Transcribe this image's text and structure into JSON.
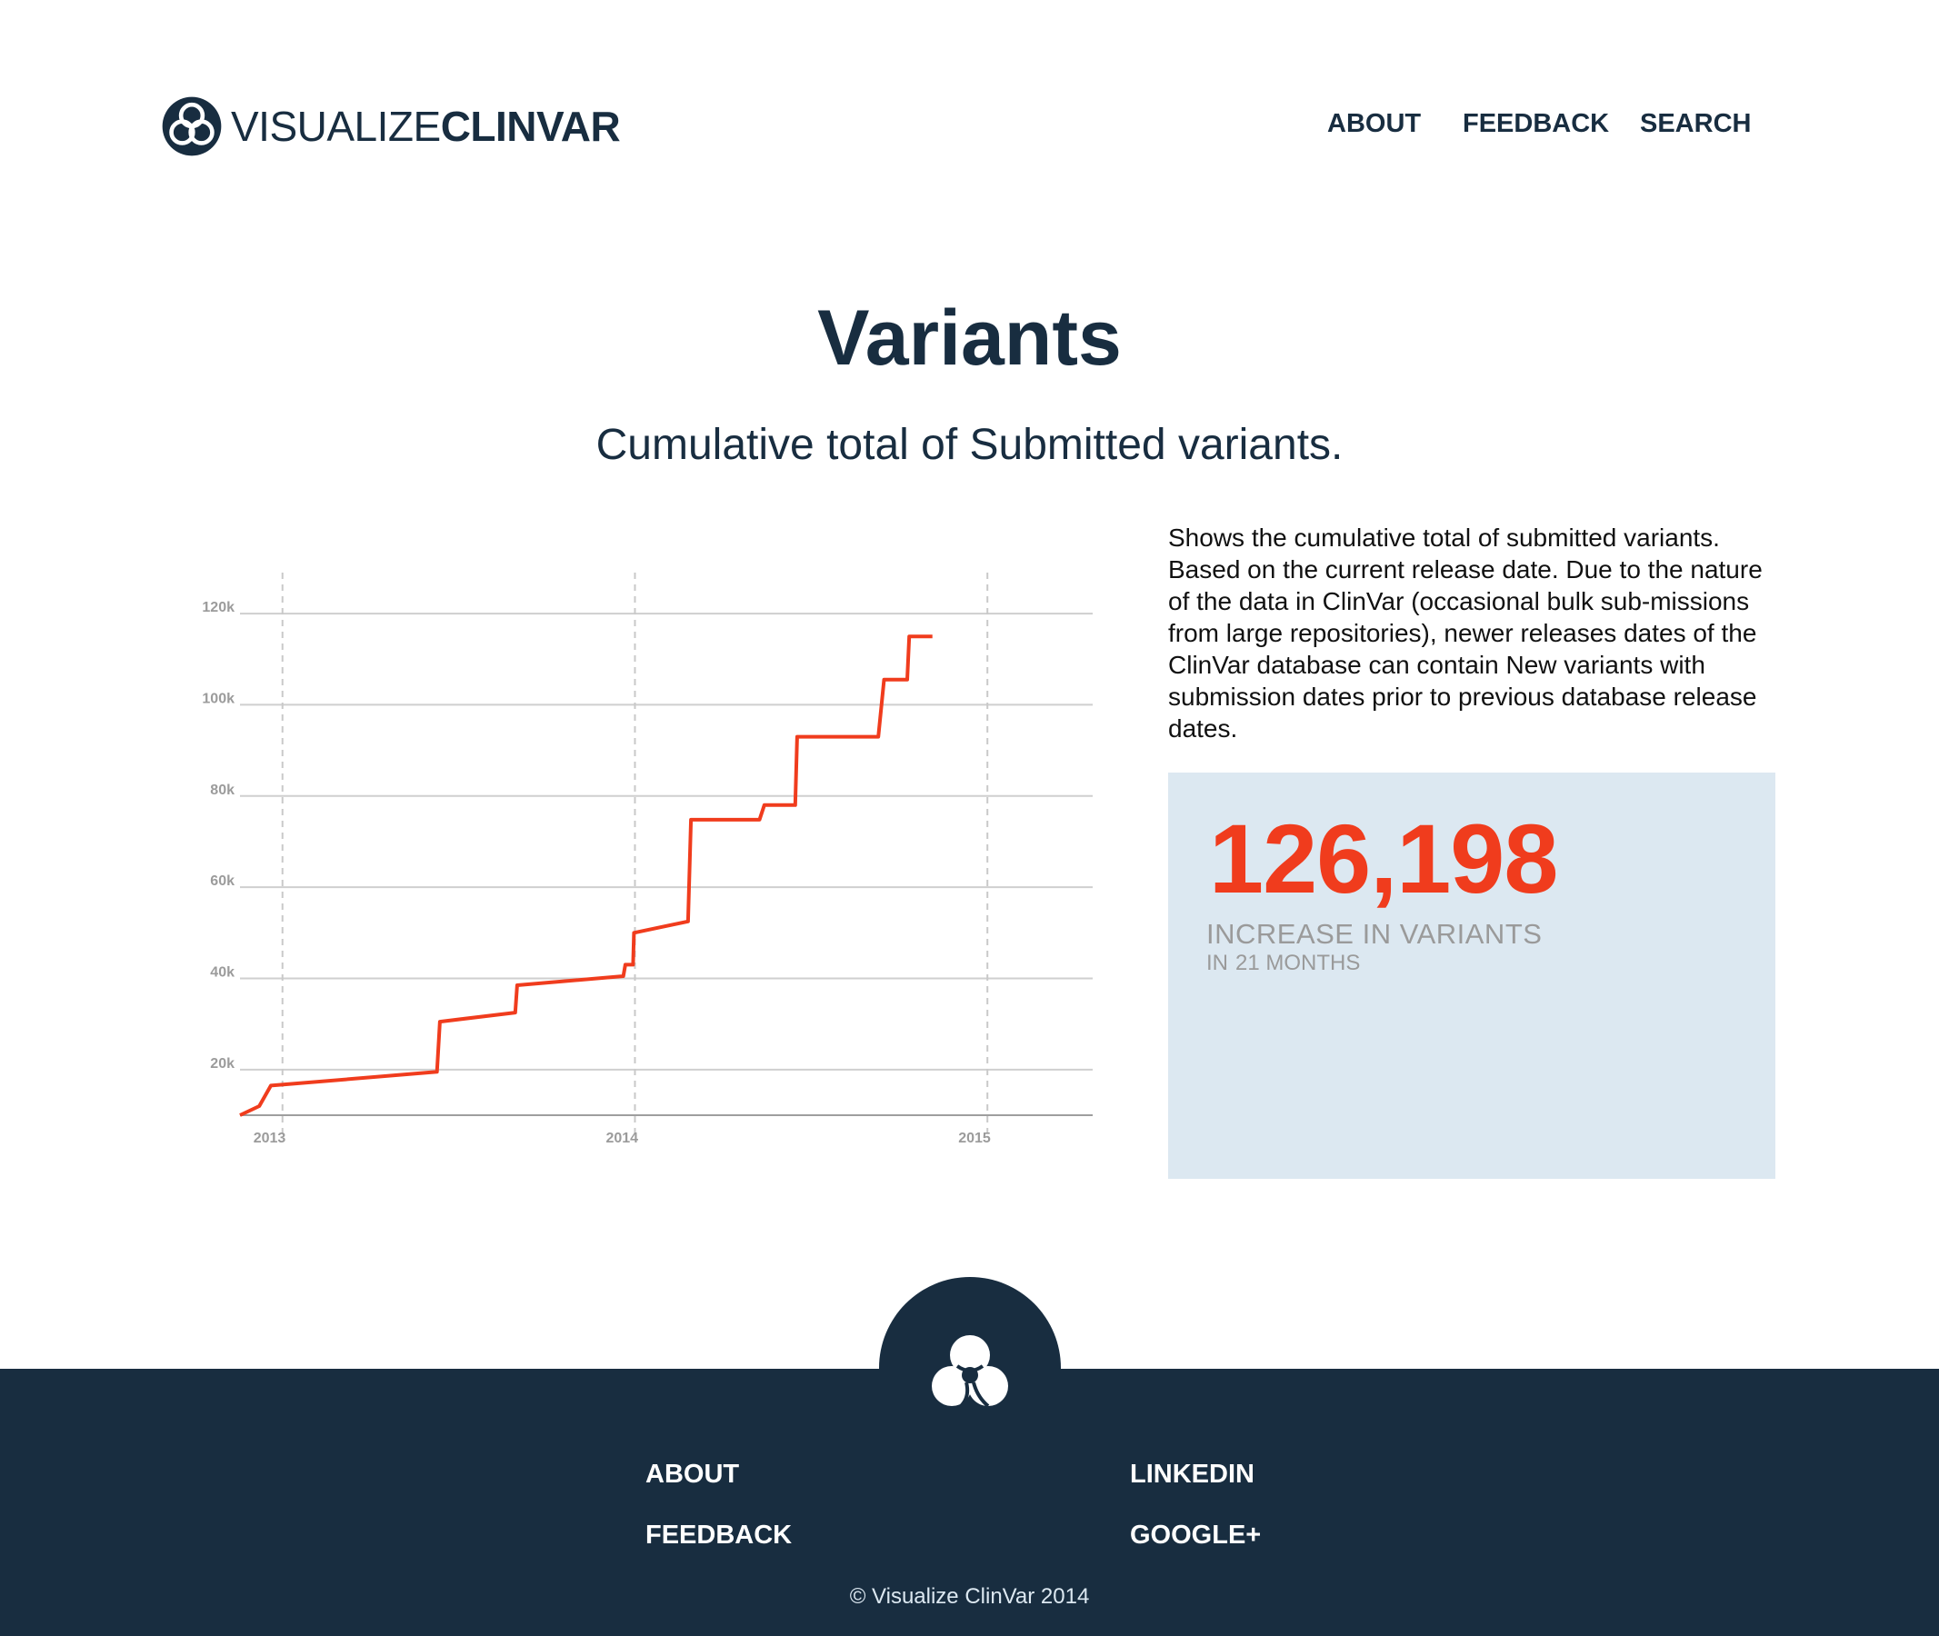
{
  "header": {
    "logo": {
      "light": "VISUALIZE",
      "bold": "CLINVAR",
      "icon": "venn-logo-icon"
    },
    "nav": [
      {
        "label": "ABOUT"
      },
      {
        "label": "FEEDBACK"
      },
      {
        "label": "SEARCH"
      }
    ]
  },
  "main": {
    "title": "Variants",
    "subtitle": "Cumulative total of Submitted variants.",
    "description": "Shows the cumulative total of submitted variants. Based on the current release date. Due to the nature of the data in ClinVar (occasional bulk sub-missions from large repositories), newer releases dates of the ClinVar database can contain New variants with submission dates prior to previous database release dates.",
    "stat": {
      "value": "126,198",
      "label": "INCREASE IN VARIANTS",
      "sub_prefix": "IN",
      "sub_value": "21 MONTHS"
    }
  },
  "chart_data": {
    "type": "line",
    "title": "",
    "xlabel": "",
    "ylabel": "",
    "color": "#f03c1d",
    "grid": "horizontal solid, vertical dashed at year ticks",
    "xlim": [
      "2012-11-18",
      "2015-04-20"
    ],
    "ylim": [
      10000,
      125000
    ],
    "x_ticks": [
      "2013",
      "2014",
      "2015"
    ],
    "y_ticks": [
      "20k",
      "40k",
      "60k",
      "80k",
      "100k",
      "120k"
    ],
    "y_tick_values": [
      20000,
      40000,
      60000,
      80000,
      100000,
      120000
    ],
    "series": [
      {
        "points": [
          [
            "2012-11-18",
            10000
          ],
          [
            "2012-12-08",
            12000
          ],
          [
            "2012-12-20",
            16500
          ],
          [
            "2013-06-10",
            19500
          ],
          [
            "2013-06-13",
            30500
          ],
          [
            "2013-08-30",
            32500
          ],
          [
            "2013-09-01",
            38500
          ],
          [
            "2013-12-20",
            40500
          ],
          [
            "2013-12-22",
            43000
          ],
          [
            "2013-12-30",
            43000
          ],
          [
            "2013-12-31",
            50000
          ],
          [
            "2014-02-25",
            52500
          ],
          [
            "2014-02-28",
            74800
          ],
          [
            "2014-05-10",
            74800
          ],
          [
            "2014-05-15",
            78000
          ],
          [
            "2014-06-16",
            78000
          ],
          [
            "2014-06-18",
            93000
          ],
          [
            "2014-09-10",
            93000
          ],
          [
            "2014-09-16",
            105500
          ],
          [
            "2014-10-10",
            105500
          ],
          [
            "2014-10-12",
            115000
          ],
          [
            "2014-11-05",
            115000
          ]
        ]
      }
    ]
  },
  "footer": {
    "links": [
      {
        "label": "ABOUT"
      },
      {
        "label": "FEEDBACK"
      },
      {
        "label": "LINKEDIN"
      },
      {
        "label": "GOOGLE+"
      }
    ],
    "copyright": "© Visualize ClinVar 2014",
    "icon": "venn-logo-icon"
  }
}
